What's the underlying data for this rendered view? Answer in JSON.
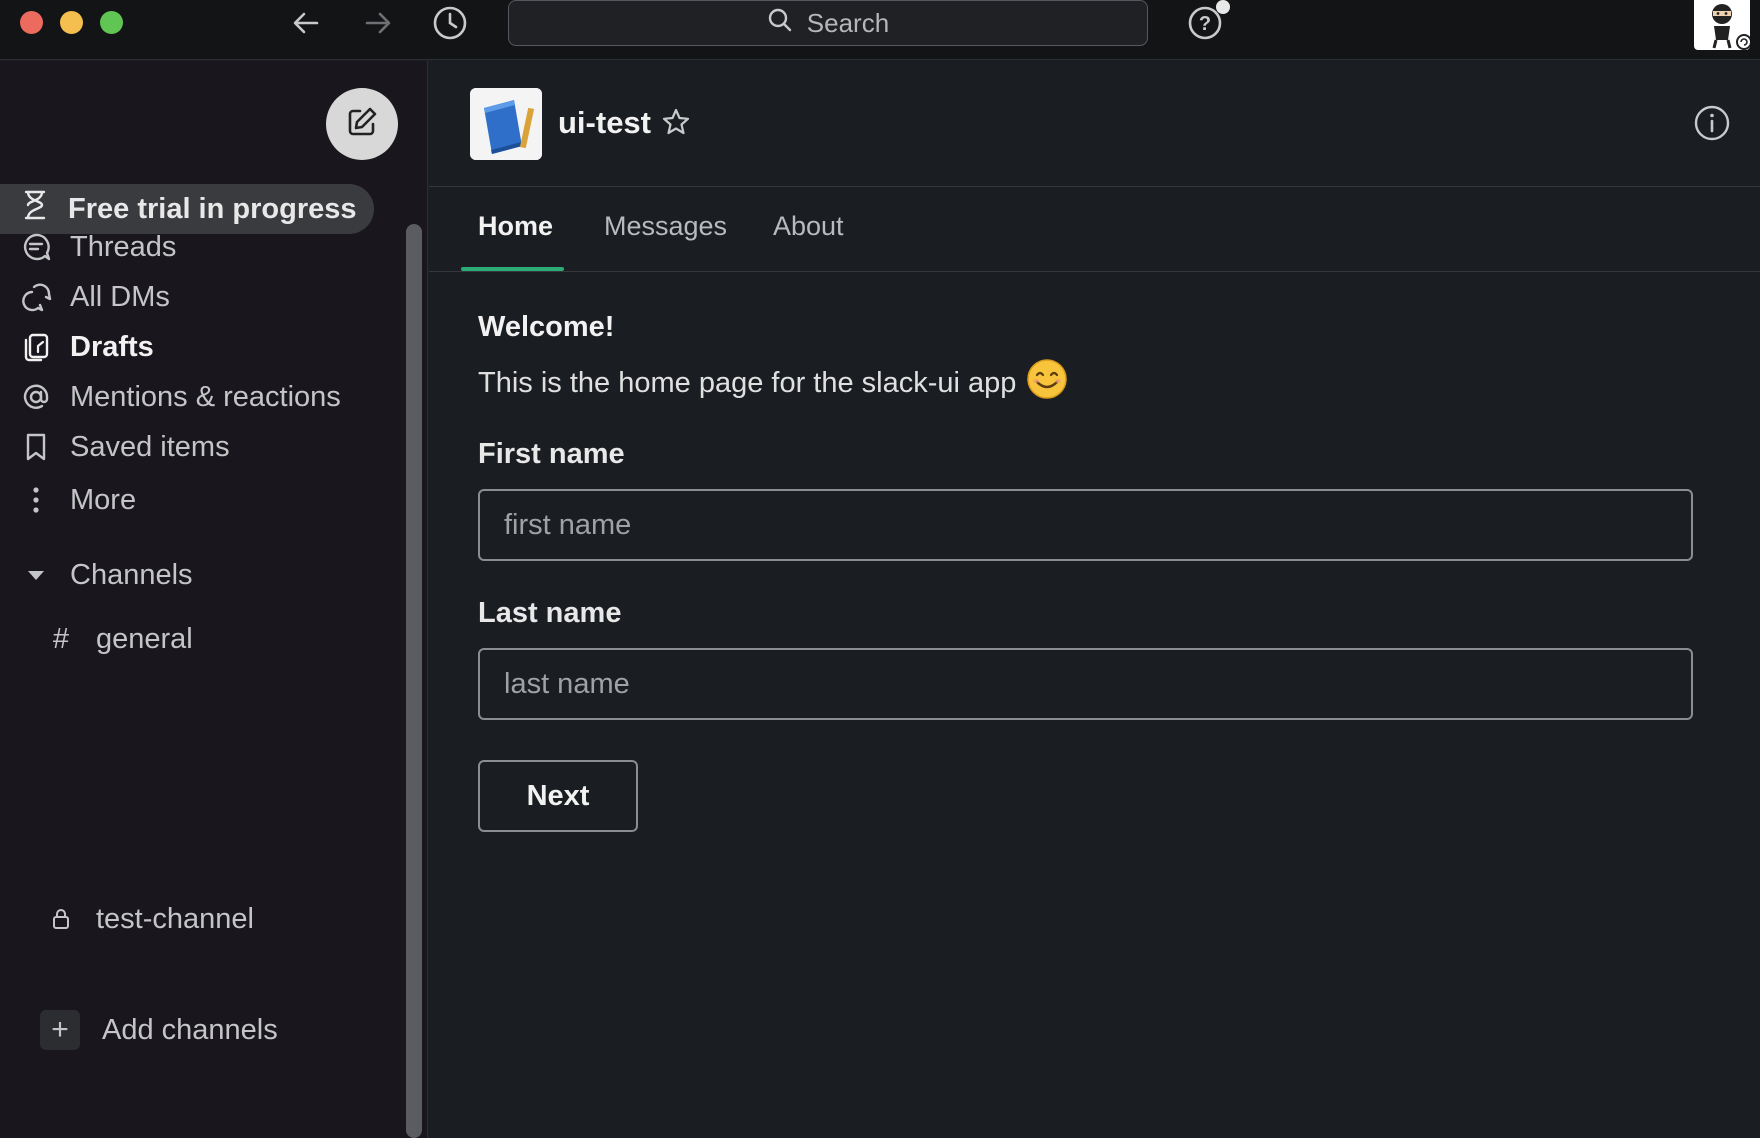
{
  "titlebar": {
    "search_placeholder": "Search",
    "icons": [
      "arrow-left-icon",
      "arrow-right-icon",
      "clock-icon",
      "search-icon",
      "help-icon",
      "avatar"
    ]
  },
  "sidebar": {
    "trial_label": "Free trial in progress",
    "items": [
      {
        "label": "Threads",
        "icon": "threads-icon"
      },
      {
        "label": "All DMs",
        "icon": "dms-icon"
      },
      {
        "label": "Drafts",
        "icon": "drafts-icon"
      },
      {
        "label": "Mentions & reactions",
        "icon": "at-icon"
      },
      {
        "label": "Saved items",
        "icon": "bookmark-icon"
      },
      {
        "label": "More",
        "icon": "more-vertical-icon"
      }
    ],
    "channels_heading": "Channels",
    "channels": [
      {
        "label": "general",
        "prefix": "#"
      },
      {
        "label": "test-channel",
        "prefix": "lock"
      }
    ],
    "add_channels_label": "Add channels"
  },
  "app": {
    "title": "ui-test",
    "tabs": [
      "Home",
      "Messages",
      "About"
    ],
    "active_tab": "Home"
  },
  "home": {
    "welcome_title": "Welcome!",
    "welcome_body": "This is the home page for the slack-ui app",
    "welcome_emoji": "😊",
    "first_name_label": "First name",
    "first_name_placeholder": "first name",
    "first_name_value": "",
    "last_name_label": "Last name",
    "last_name_placeholder": "last name",
    "last_name_value": "",
    "next_label": "Next"
  },
  "colors": {
    "accent_green": "#2bac76",
    "background": "#1a1d21",
    "sidebar_bg": "#19171d"
  }
}
